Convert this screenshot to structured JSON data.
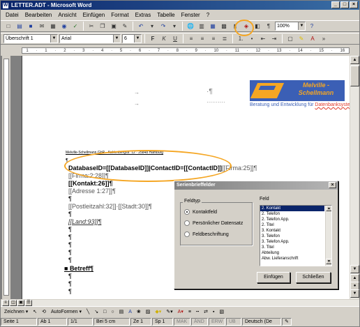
{
  "window": {
    "title": "LETTER.ADT - Microsoft Word",
    "controls": [
      "_",
      "□",
      "×"
    ]
  },
  "menu": {
    "items": [
      "Datei",
      "Bearbeiten",
      "Ansicht",
      "Einfügen",
      "Format",
      "Extras",
      "Tabelle",
      "Fenster",
      "?"
    ]
  },
  "toolbar": {
    "zoom": "100%",
    "style_value": "Überschrift 1",
    "font_value": "Arial",
    "size_value": "6"
  },
  "document": {
    "logo": {
      "line1": "Melville -",
      "line2": "Schellmann",
      "tagline_prefix": "Beratung und Entwicklung für",
      "tagline_suffix": "Datenbanksysteme"
    },
    "small_header": "Melville-Schellmann GbR · Kahlenbergstr. 12 · 25848 Hamburg",
    "line_db": "DatabaseID=[[DatabaseID]]|ContactID=[[ContactID]]",
    "line_db_tail": "[[Firma:25]]¶",
    "line_firma": "[[Firma:2:28]]¶",
    "line_kontakt": "[[Kontakt:26]]¶",
    "line_adresse": "[[Adresse 1:27]]¶",
    "line_postleitzahl": "[[Postleitzahl:32]]·[[Stadt:30]]¶",
    "line_land": "[[Land:93]]¶",
    "pilcrow": "¶",
    "betreff": "Betreff¶"
  },
  "dialog": {
    "title": "Serienbrieffelder",
    "group_label": "Feldtyp",
    "options": [
      "Kontaktfeld",
      "Persönlicher Datensatz",
      "Feldbeschriftung"
    ],
    "feld_label": "Feld",
    "fields": [
      "2. Kontakt",
      "2. Telefon",
      "2. Telefon App.",
      "2. Titel",
      "3. Kontakt",
      "3. Telefon",
      "3. Telefon App.",
      "3. Titel",
      "Abteilung",
      "Abw. Lieferanschrift"
    ],
    "insert_button": "Einfügen",
    "close_button": "Schließen"
  },
  "drawbar": {
    "zeichnen": "Zeichnen",
    "autoformen": "AutoFormen"
  },
  "status": {
    "seite": "Seite 1",
    "ab": "Ab 1",
    "pages": "1/1",
    "bei": "Bei 5 cm",
    "ze": "Ze 1",
    "sp": "Sp 1",
    "mak": "MAK",
    "and": "ÄND",
    "erw": "ERW",
    "ub": "ÜB",
    "language": "Deutsch (De"
  }
}
